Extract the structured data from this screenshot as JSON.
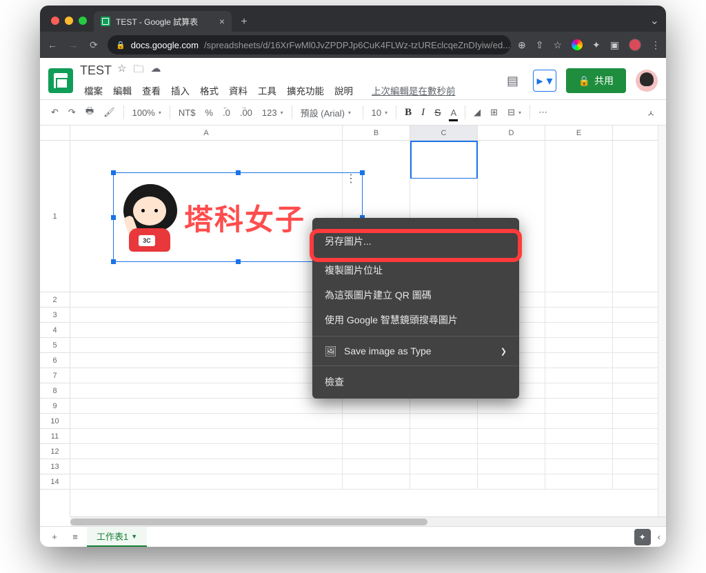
{
  "browser": {
    "tab_title": "TEST - Google 試算表",
    "url_host": "docs.google.com",
    "url_path": "/spreadsheets/d/16XrFwMl0JvZPDPJp6CuK4FLWz-tzUREclcqeZnDIyiw/ed..."
  },
  "doc": {
    "title": "TEST",
    "last_edit": "上次編輯是在數秒前"
  },
  "menus": {
    "file": "檔案",
    "edit": "編輯",
    "view": "查看",
    "insert": "插入",
    "format": "格式",
    "data": "資料",
    "tools": "工具",
    "extensions": "擴充功能",
    "help": "說明"
  },
  "share_label": "共用",
  "toolbar": {
    "zoom": "100%",
    "currency": "NT$",
    "percent": "%",
    "dec_dec": ".0",
    "inc_dec": ".00",
    "num_format": "123",
    "font": "預設 (Arial)",
    "font_size": "10"
  },
  "columns": [
    "A",
    "B",
    "C",
    "D",
    "E"
  ],
  "rows": [
    "1",
    "2",
    "3",
    "4",
    "5",
    "6",
    "7",
    "8",
    "9",
    "10",
    "11",
    "12",
    "13",
    "14"
  ],
  "sheet_tab": "工作表1",
  "image": {
    "text": "塔科女子",
    "badge": "3C"
  },
  "context_menu": {
    "save_as": "另存圖片...",
    "copy_addr": "複製圖片位址",
    "create_qr": "為這張圖片建立 QR 圖碼",
    "lens": "使用 Google 智慧鏡頭搜尋圖片",
    "save_type": "Save image as Type",
    "inspect": "檢查"
  }
}
